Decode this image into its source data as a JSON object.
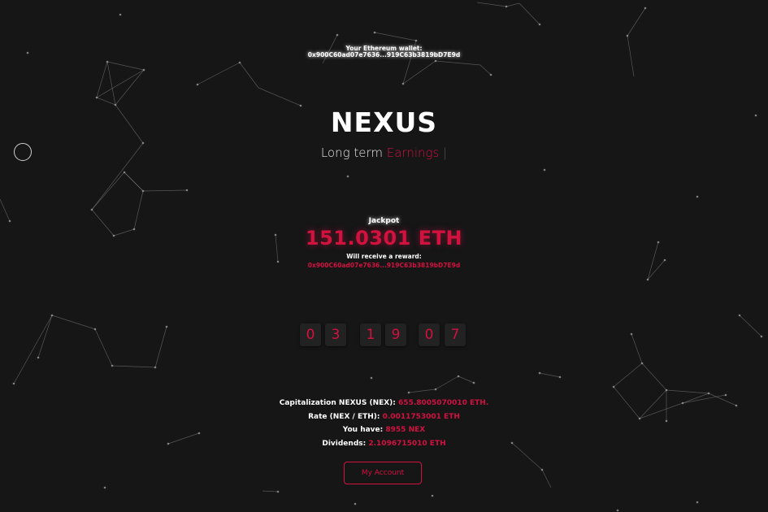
{
  "wallet": {
    "label": "Your Ethereum wallet:",
    "address": "0x900C60ad07e7636...919C63b3819bD7E9d"
  },
  "hero": {
    "title": "NEXUS",
    "tagline_prefix": "Long term",
    "tagline_accent": "Earnings",
    "tagline_cursor": "|"
  },
  "jackpot": {
    "label": "Jackpot",
    "value": "151.0301 ETH",
    "reward_label": "Will receive a reward:",
    "reward_address": "0x900C60ad07e7636...919C63b3819bD7E9d"
  },
  "timer": {
    "digits": [
      "0",
      "3",
      "1",
      "9",
      "0",
      "7"
    ]
  },
  "stats": [
    {
      "label": "Capitalization NEXUS (NEX):",
      "value": "655.8005070010 ETH."
    },
    {
      "label": "Rate (NEX / ETH):",
      "value": "0.0011753001 ETH"
    },
    {
      "label": "You have:",
      "value": "8955 NEX"
    },
    {
      "label": "Dividends:",
      "value": "2.1096715010 ETH"
    }
  ],
  "account_button": "My Account",
  "colors": {
    "background": "#161617",
    "accent": "#d1123f",
    "text": "#ffffff",
    "network_lines": "#8a8a8a"
  }
}
